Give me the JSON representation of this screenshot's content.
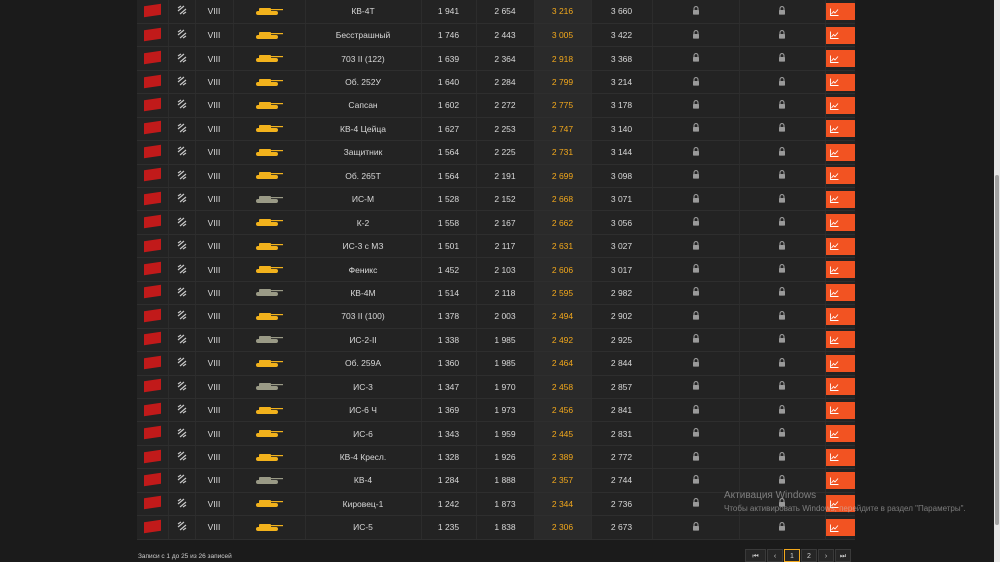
{
  "colors": {
    "accent": "#f25322",
    "highlight": "#f2a81c",
    "background": "#1b1b1b",
    "flag": "#c11a1a"
  },
  "icons": {
    "nation": "ussr-flag-icon",
    "type": "heavy-tank-icon",
    "private": "lock-icon",
    "stats": "chart-line-icon"
  },
  "rows": [
    {
      "tier": "VIII",
      "name": "КВ-4Т",
      "v1": "1 941",
      "v2": "2 654",
      "v3": "3 216",
      "v4": "3 660",
      "gold": true
    },
    {
      "tier": "VIII",
      "name": "Бесстрашный",
      "v1": "1 746",
      "v2": "2 443",
      "v3": "3 005",
      "v4": "3 422",
      "gold": true
    },
    {
      "tier": "VIII",
      "name": "703 II (122)",
      "v1": "1 639",
      "v2": "2 364",
      "v3": "2 918",
      "v4": "3 368",
      "gold": true
    },
    {
      "tier": "VIII",
      "name": "Об. 252У",
      "v1": "1 640",
      "v2": "2 284",
      "v3": "2 799",
      "v4": "3 214",
      "gold": true
    },
    {
      "tier": "VIII",
      "name": "Сапсан",
      "v1": "1 602",
      "v2": "2 272",
      "v3": "2 775",
      "v4": "3 178",
      "gold": true
    },
    {
      "tier": "VIII",
      "name": "КВ-4 Цейца",
      "v1": "1 627",
      "v2": "2 253",
      "v3": "2 747",
      "v4": "3 140",
      "gold": true
    },
    {
      "tier": "VIII",
      "name": "Защитник",
      "v1": "1 564",
      "v2": "2 225",
      "v3": "2 731",
      "v4": "3 144",
      "gold": true
    },
    {
      "tier": "VIII",
      "name": "Об. 265Т",
      "v1": "1 564",
      "v2": "2 191",
      "v3": "2 699",
      "v4": "3 098",
      "gold": true
    },
    {
      "tier": "VIII",
      "name": "ИС-М",
      "v1": "1 528",
      "v2": "2 152",
      "v3": "2 668",
      "v4": "3 071",
      "gold": false
    },
    {
      "tier": "VIII",
      "name": "К-2",
      "v1": "1 558",
      "v2": "2 167",
      "v3": "2 662",
      "v4": "3 056",
      "gold": true
    },
    {
      "tier": "VIII",
      "name": "ИС-3 с МЗ",
      "v1": "1 501",
      "v2": "2 117",
      "v3": "2 631",
      "v4": "3 027",
      "gold": true
    },
    {
      "tier": "VIII",
      "name": "Феникс",
      "v1": "1 452",
      "v2": "2 103",
      "v3": "2 606",
      "v4": "3 017",
      "gold": true
    },
    {
      "tier": "VIII",
      "name": "КВ-4М",
      "v1": "1 514",
      "v2": "2 118",
      "v3": "2 595",
      "v4": "2 982",
      "gold": false
    },
    {
      "tier": "VIII",
      "name": "703 II (100)",
      "v1": "1 378",
      "v2": "2 003",
      "v3": "2 494",
      "v4": "2 902",
      "gold": true
    },
    {
      "tier": "VIII",
      "name": "ИС-2-II",
      "v1": "1 338",
      "v2": "1 985",
      "v3": "2 492",
      "v4": "2 925",
      "gold": false
    },
    {
      "tier": "VIII",
      "name": "Об. 259А",
      "v1": "1 360",
      "v2": "1 985",
      "v3": "2 464",
      "v4": "2 844",
      "gold": true
    },
    {
      "tier": "VIII",
      "name": "ИС-3",
      "v1": "1 347",
      "v2": "1 970",
      "v3": "2 458",
      "v4": "2 857",
      "gold": false
    },
    {
      "tier": "VIII",
      "name": "ИС-6 Ч",
      "v1": "1 369",
      "v2": "1 973",
      "v3": "2 456",
      "v4": "2 841",
      "gold": true
    },
    {
      "tier": "VIII",
      "name": "ИС-6",
      "v1": "1 343",
      "v2": "1 959",
      "v3": "2 445",
      "v4": "2 831",
      "gold": true
    },
    {
      "tier": "VIII",
      "name": "КВ-4 Кресл.",
      "v1": "1 328",
      "v2": "1 926",
      "v3": "2 389",
      "v4": "2 772",
      "gold": true
    },
    {
      "tier": "VIII",
      "name": "КВ-4",
      "v1": "1 284",
      "v2": "1 888",
      "v3": "2 357",
      "v4": "2 744",
      "gold": false
    },
    {
      "tier": "VIII",
      "name": "Кировец-1",
      "v1": "1 242",
      "v2": "1 873",
      "v3": "2 344",
      "v4": "2 736",
      "gold": true
    },
    {
      "tier": "VIII",
      "name": "ИС-5",
      "v1": "1 235",
      "v2": "1 838",
      "v3": "2 306",
      "v4": "2 673",
      "gold": true
    }
  ],
  "footer": {
    "info": "Записи с 1 до 25 из 26 записей"
  },
  "pagination": {
    "first": "⏮",
    "prev": "‹",
    "pages": [
      "1",
      "2"
    ],
    "next": "›",
    "last": "⏭"
  },
  "watermark": {
    "title": "Активация Windows",
    "subtitle": "Чтобы активировать Windows, перейдите в раздел \"Параметры\"."
  }
}
